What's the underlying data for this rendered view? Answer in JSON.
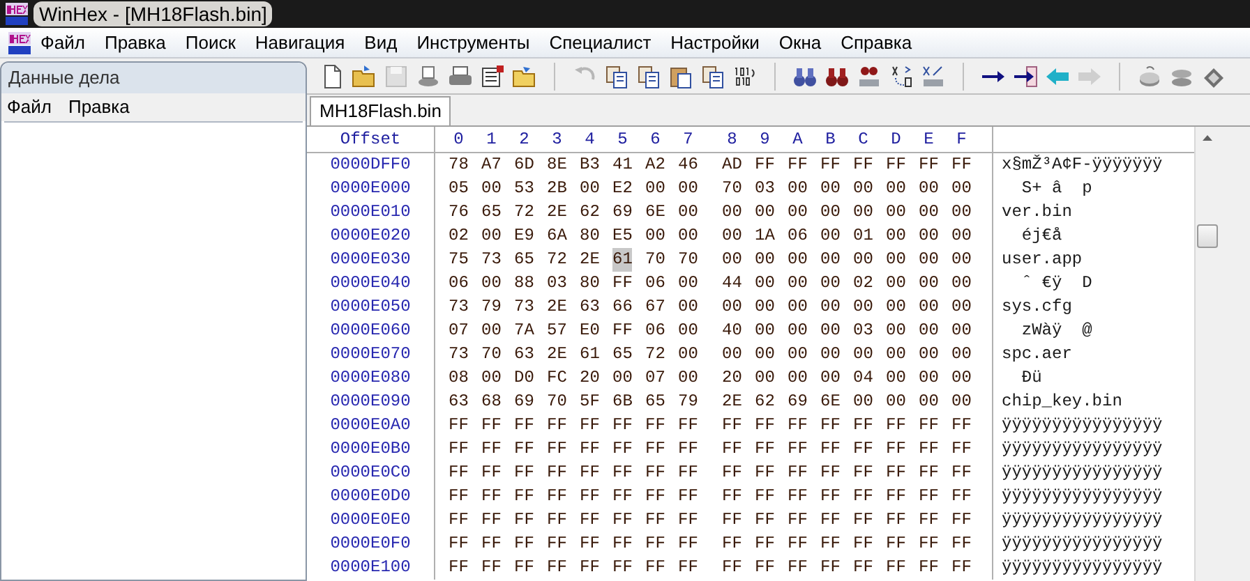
{
  "window": {
    "title": "WinHex - [MH18Flash.bin]"
  },
  "menu": [
    "Файл",
    "Правка",
    "Поиск",
    "Навигация",
    "Вид",
    "Инструменты",
    "Специалист",
    "Настройки",
    "Окна",
    "Справка"
  ],
  "side_panel": {
    "title": "Данные дела",
    "menu": [
      "Файл",
      "Правка"
    ]
  },
  "toolbar": [
    {
      "kind": "new",
      "disabled": false
    },
    {
      "kind": "open",
      "disabled": false
    },
    {
      "kind": "save",
      "disabled": true
    },
    {
      "kind": "disk",
      "disabled": false
    },
    {
      "kind": "print",
      "disabled": false
    },
    {
      "kind": "props",
      "disabled": false
    },
    {
      "kind": "folder",
      "disabled": false
    },
    {
      "kind": "sep"
    },
    {
      "kind": "undo",
      "disabled": true
    },
    {
      "kind": "copy",
      "disabled": false
    },
    {
      "kind": "copy",
      "disabled": false
    },
    {
      "kind": "paste",
      "disabled": false
    },
    {
      "kind": "copy",
      "disabled": false
    },
    {
      "kind": "binary",
      "disabled": false
    },
    {
      "kind": "sep"
    },
    {
      "kind": "find",
      "disabled": false
    },
    {
      "kind": "findred",
      "disabled": false
    },
    {
      "kind": "findhex",
      "disabled": false
    },
    {
      "kind": "replace",
      "disabled": false
    },
    {
      "kind": "replacehex",
      "disabled": false
    },
    {
      "kind": "sep"
    },
    {
      "kind": "goto",
      "disabled": false
    },
    {
      "kind": "gotobox",
      "disabled": false
    },
    {
      "kind": "back",
      "disabled": false
    },
    {
      "kind": "forward",
      "disabled": true
    },
    {
      "kind": "sep"
    },
    {
      "kind": "drive",
      "disabled": false
    },
    {
      "kind": "drives",
      "disabled": false
    },
    {
      "kind": "chip",
      "disabled": false
    }
  ],
  "tabs": [
    {
      "label": "MH18Flash.bin",
      "selected": true
    }
  ],
  "hex_view": {
    "offset_header": "Offset",
    "columns": [
      "0",
      "1",
      "2",
      "3",
      "4",
      "5",
      "6",
      "7",
      "8",
      "9",
      "A",
      "B",
      "C",
      "D",
      "E",
      "F"
    ],
    "rows": [
      {
        "offset": "0000DFF0",
        "bytes": [
          {
            "t": "78",
            "s": false
          },
          {
            "t": "A7",
            "s": false
          },
          {
            "t": "6D",
            "s": false
          },
          {
            "t": "8E",
            "s": false
          },
          {
            "t": "B3",
            "s": false
          },
          {
            "t": "41",
            "s": false
          },
          {
            "t": "A2",
            "s": false
          },
          {
            "t": "46",
            "s": false
          },
          {
            "t": "AD",
            "s": false
          },
          {
            "t": "FF",
            "s": false
          },
          {
            "t": "FF",
            "s": false
          },
          {
            "t": "FF",
            "s": false
          },
          {
            "t": "FF",
            "s": false
          },
          {
            "t": "FF",
            "s": false
          },
          {
            "t": "FF",
            "s": false
          },
          {
            "t": "FF",
            "s": false
          }
        ],
        "text": "x§mŽ³A¢F-ÿÿÿÿÿÿÿ"
      },
      {
        "offset": "0000E000",
        "bytes": [
          {
            "t": "05",
            "s": false
          },
          {
            "t": "00",
            "s": false
          },
          {
            "t": "53",
            "s": false
          },
          {
            "t": "2B",
            "s": false
          },
          {
            "t": "00",
            "s": false
          },
          {
            "t": "E2",
            "s": false
          },
          {
            "t": "00",
            "s": false
          },
          {
            "t": "00",
            "s": false
          },
          {
            "t": "70",
            "s": false
          },
          {
            "t": "03",
            "s": false
          },
          {
            "t": "00",
            "s": false
          },
          {
            "t": "00",
            "s": false
          },
          {
            "t": "00",
            "s": false
          },
          {
            "t": "00",
            "s": false
          },
          {
            "t": "00",
            "s": false
          },
          {
            "t": "00",
            "s": false
          }
        ],
        "text": "  S+ â  p"
      },
      {
        "offset": "0000E010",
        "bytes": [
          {
            "t": "76",
            "s": false
          },
          {
            "t": "65",
            "s": false
          },
          {
            "t": "72",
            "s": false
          },
          {
            "t": "2E",
            "s": false
          },
          {
            "t": "62",
            "s": false
          },
          {
            "t": "69",
            "s": false
          },
          {
            "t": "6E",
            "s": false
          },
          {
            "t": "00",
            "s": false
          },
          {
            "t": "00",
            "s": false
          },
          {
            "t": "00",
            "s": false
          },
          {
            "t": "00",
            "s": false
          },
          {
            "t": "00",
            "s": false
          },
          {
            "t": "00",
            "s": false
          },
          {
            "t": "00",
            "s": false
          },
          {
            "t": "00",
            "s": false
          },
          {
            "t": "00",
            "s": false
          }
        ],
        "text": "ver.bin"
      },
      {
        "offset": "0000E020",
        "bytes": [
          {
            "t": "02",
            "s": false
          },
          {
            "t": "00",
            "s": false
          },
          {
            "t": "E9",
            "s": false
          },
          {
            "t": "6A",
            "s": false
          },
          {
            "t": "80",
            "s": false
          },
          {
            "t": "E5",
            "s": false
          },
          {
            "t": "00",
            "s": false
          },
          {
            "t": "00",
            "s": false
          },
          {
            "t": "00",
            "s": false
          },
          {
            "t": "1A",
            "s": false
          },
          {
            "t": "06",
            "s": false
          },
          {
            "t": "00",
            "s": false
          },
          {
            "t": "01",
            "s": false
          },
          {
            "t": "00",
            "s": false
          },
          {
            "t": "00",
            "s": false
          },
          {
            "t": "00",
            "s": false
          }
        ],
        "text": "  éj€å"
      },
      {
        "offset": "0000E030",
        "bytes": [
          {
            "t": "75",
            "s": false
          },
          {
            "t": "73",
            "s": false
          },
          {
            "t": "65",
            "s": false
          },
          {
            "t": "72",
            "s": false
          },
          {
            "t": "2E",
            "s": false
          },
          {
            "t": "61",
            "s": true
          },
          {
            "t": "70",
            "s": false
          },
          {
            "t": "70",
            "s": false
          },
          {
            "t": "00",
            "s": false
          },
          {
            "t": "00",
            "s": false
          },
          {
            "t": "00",
            "s": false
          },
          {
            "t": "00",
            "s": false
          },
          {
            "t": "00",
            "s": false
          },
          {
            "t": "00",
            "s": false
          },
          {
            "t": "00",
            "s": false
          },
          {
            "t": "00",
            "s": false
          }
        ],
        "text": "user.app"
      },
      {
        "offset": "0000E040",
        "bytes": [
          {
            "t": "06",
            "s": false
          },
          {
            "t": "00",
            "s": false
          },
          {
            "t": "88",
            "s": false
          },
          {
            "t": "03",
            "s": false
          },
          {
            "t": "80",
            "s": false
          },
          {
            "t": "FF",
            "s": false
          },
          {
            "t": "06",
            "s": false
          },
          {
            "t": "00",
            "s": false
          },
          {
            "t": "44",
            "s": false
          },
          {
            "t": "00",
            "s": false
          },
          {
            "t": "00",
            "s": false
          },
          {
            "t": "00",
            "s": false
          },
          {
            "t": "02",
            "s": false
          },
          {
            "t": "00",
            "s": false
          },
          {
            "t": "00",
            "s": false
          },
          {
            "t": "00",
            "s": false
          }
        ],
        "text": "  ˆ €ÿ  D"
      },
      {
        "offset": "0000E050",
        "bytes": [
          {
            "t": "73",
            "s": false
          },
          {
            "t": "79",
            "s": false
          },
          {
            "t": "73",
            "s": false
          },
          {
            "t": "2E",
            "s": false
          },
          {
            "t": "63",
            "s": false
          },
          {
            "t": "66",
            "s": false
          },
          {
            "t": "67",
            "s": false
          },
          {
            "t": "00",
            "s": false
          },
          {
            "t": "00",
            "s": false
          },
          {
            "t": "00",
            "s": false
          },
          {
            "t": "00",
            "s": false
          },
          {
            "t": "00",
            "s": false
          },
          {
            "t": "00",
            "s": false
          },
          {
            "t": "00",
            "s": false
          },
          {
            "t": "00",
            "s": false
          },
          {
            "t": "00",
            "s": false
          }
        ],
        "text": "sys.cfg"
      },
      {
        "offset": "0000E060",
        "bytes": [
          {
            "t": "07",
            "s": false
          },
          {
            "t": "00",
            "s": false
          },
          {
            "t": "7A",
            "s": false
          },
          {
            "t": "57",
            "s": false
          },
          {
            "t": "E0",
            "s": false
          },
          {
            "t": "FF",
            "s": false
          },
          {
            "t": "06",
            "s": false
          },
          {
            "t": "00",
            "s": false
          },
          {
            "t": "40",
            "s": false
          },
          {
            "t": "00",
            "s": false
          },
          {
            "t": "00",
            "s": false
          },
          {
            "t": "00",
            "s": false
          },
          {
            "t": "03",
            "s": false
          },
          {
            "t": "00",
            "s": false
          },
          {
            "t": "00",
            "s": false
          },
          {
            "t": "00",
            "s": false
          }
        ],
        "text": "  zWàÿ  @"
      },
      {
        "offset": "0000E070",
        "bytes": [
          {
            "t": "73",
            "s": false
          },
          {
            "t": "70",
            "s": false
          },
          {
            "t": "63",
            "s": false
          },
          {
            "t": "2E",
            "s": false
          },
          {
            "t": "61",
            "s": false
          },
          {
            "t": "65",
            "s": false
          },
          {
            "t": "72",
            "s": false
          },
          {
            "t": "00",
            "s": false
          },
          {
            "t": "00",
            "s": false
          },
          {
            "t": "00",
            "s": false
          },
          {
            "t": "00",
            "s": false
          },
          {
            "t": "00",
            "s": false
          },
          {
            "t": "00",
            "s": false
          },
          {
            "t": "00",
            "s": false
          },
          {
            "t": "00",
            "s": false
          },
          {
            "t": "00",
            "s": false
          }
        ],
        "text": "spc.aer"
      },
      {
        "offset": "0000E080",
        "bytes": [
          {
            "t": "08",
            "s": false
          },
          {
            "t": "00",
            "s": false
          },
          {
            "t": "D0",
            "s": false
          },
          {
            "t": "FC",
            "s": false
          },
          {
            "t": "20",
            "s": false
          },
          {
            "t": "00",
            "s": false
          },
          {
            "t": "07",
            "s": false
          },
          {
            "t": "00",
            "s": false
          },
          {
            "t": "20",
            "s": false
          },
          {
            "t": "00",
            "s": false
          },
          {
            "t": "00",
            "s": false
          },
          {
            "t": "00",
            "s": false
          },
          {
            "t": "04",
            "s": false
          },
          {
            "t": "00",
            "s": false
          },
          {
            "t": "00",
            "s": false
          },
          {
            "t": "00",
            "s": false
          }
        ],
        "text": "  Ðü"
      },
      {
        "offset": "0000E090",
        "bytes": [
          {
            "t": "63",
            "s": false
          },
          {
            "t": "68",
            "s": false
          },
          {
            "t": "69",
            "s": false
          },
          {
            "t": "70",
            "s": false
          },
          {
            "t": "5F",
            "s": false
          },
          {
            "t": "6B",
            "s": false
          },
          {
            "t": "65",
            "s": false
          },
          {
            "t": "79",
            "s": false
          },
          {
            "t": "2E",
            "s": false
          },
          {
            "t": "62",
            "s": false
          },
          {
            "t": "69",
            "s": false
          },
          {
            "t": "6E",
            "s": false
          },
          {
            "t": "00",
            "s": false
          },
          {
            "t": "00",
            "s": false
          },
          {
            "t": "00",
            "s": false
          },
          {
            "t": "00",
            "s": false
          }
        ],
        "text": "chip_key.bin"
      },
      {
        "offset": "0000E0A0",
        "bytes": [
          {
            "t": "FF",
            "s": false
          },
          {
            "t": "FF",
            "s": false
          },
          {
            "t": "FF",
            "s": false
          },
          {
            "t": "FF",
            "s": false
          },
          {
            "t": "FF",
            "s": false
          },
          {
            "t": "FF",
            "s": false
          },
          {
            "t": "FF",
            "s": false
          },
          {
            "t": "FF",
            "s": false
          },
          {
            "t": "FF",
            "s": false
          },
          {
            "t": "FF",
            "s": false
          },
          {
            "t": "FF",
            "s": false
          },
          {
            "t": "FF",
            "s": false
          },
          {
            "t": "FF",
            "s": false
          },
          {
            "t": "FF",
            "s": false
          },
          {
            "t": "FF",
            "s": false
          },
          {
            "t": "FF",
            "s": false
          }
        ],
        "text": "ÿÿÿÿÿÿÿÿÿÿÿÿÿÿÿÿ"
      },
      {
        "offset": "0000E0B0",
        "bytes": [
          {
            "t": "FF",
            "s": false
          },
          {
            "t": "FF",
            "s": false
          },
          {
            "t": "FF",
            "s": false
          },
          {
            "t": "FF",
            "s": false
          },
          {
            "t": "FF",
            "s": false
          },
          {
            "t": "FF",
            "s": false
          },
          {
            "t": "FF",
            "s": false
          },
          {
            "t": "FF",
            "s": false
          },
          {
            "t": "FF",
            "s": false
          },
          {
            "t": "FF",
            "s": false
          },
          {
            "t": "FF",
            "s": false
          },
          {
            "t": "FF",
            "s": false
          },
          {
            "t": "FF",
            "s": false
          },
          {
            "t": "FF",
            "s": false
          },
          {
            "t": "FF",
            "s": false
          },
          {
            "t": "FF",
            "s": false
          }
        ],
        "text": "ÿÿÿÿÿÿÿÿÿÿÿÿÿÿÿÿ"
      },
      {
        "offset": "0000E0C0",
        "bytes": [
          {
            "t": "FF",
            "s": false
          },
          {
            "t": "FF",
            "s": false
          },
          {
            "t": "FF",
            "s": false
          },
          {
            "t": "FF",
            "s": false
          },
          {
            "t": "FF",
            "s": false
          },
          {
            "t": "FF",
            "s": false
          },
          {
            "t": "FF",
            "s": false
          },
          {
            "t": "FF",
            "s": false
          },
          {
            "t": "FF",
            "s": false
          },
          {
            "t": "FF",
            "s": false
          },
          {
            "t": "FF",
            "s": false
          },
          {
            "t": "FF",
            "s": false
          },
          {
            "t": "FF",
            "s": false
          },
          {
            "t": "FF",
            "s": false
          },
          {
            "t": "FF",
            "s": false
          },
          {
            "t": "FF",
            "s": false
          }
        ],
        "text": "ÿÿÿÿÿÿÿÿÿÿÿÿÿÿÿÿ"
      },
      {
        "offset": "0000E0D0",
        "bytes": [
          {
            "t": "FF",
            "s": false
          },
          {
            "t": "FF",
            "s": false
          },
          {
            "t": "FF",
            "s": false
          },
          {
            "t": "FF",
            "s": false
          },
          {
            "t": "FF",
            "s": false
          },
          {
            "t": "FF",
            "s": false
          },
          {
            "t": "FF",
            "s": false
          },
          {
            "t": "FF",
            "s": false
          },
          {
            "t": "FF",
            "s": false
          },
          {
            "t": "FF",
            "s": false
          },
          {
            "t": "FF",
            "s": false
          },
          {
            "t": "FF",
            "s": false
          },
          {
            "t": "FF",
            "s": false
          },
          {
            "t": "FF",
            "s": false
          },
          {
            "t": "FF",
            "s": false
          },
          {
            "t": "FF",
            "s": false
          }
        ],
        "text": "ÿÿÿÿÿÿÿÿÿÿÿÿÿÿÿÿ"
      },
      {
        "offset": "0000E0E0",
        "bytes": [
          {
            "t": "FF",
            "s": false
          },
          {
            "t": "FF",
            "s": false
          },
          {
            "t": "FF",
            "s": false
          },
          {
            "t": "FF",
            "s": false
          },
          {
            "t": "FF",
            "s": false
          },
          {
            "t": "FF",
            "s": false
          },
          {
            "t": "FF",
            "s": false
          },
          {
            "t": "FF",
            "s": false
          },
          {
            "t": "FF",
            "s": false
          },
          {
            "t": "FF",
            "s": false
          },
          {
            "t": "FF",
            "s": false
          },
          {
            "t": "FF",
            "s": false
          },
          {
            "t": "FF",
            "s": false
          },
          {
            "t": "FF",
            "s": false
          },
          {
            "t": "FF",
            "s": false
          },
          {
            "t": "FF",
            "s": false
          }
        ],
        "text": "ÿÿÿÿÿÿÿÿÿÿÿÿÿÿÿÿ"
      },
      {
        "offset": "0000E0F0",
        "bytes": [
          {
            "t": "FF",
            "s": false
          },
          {
            "t": "FF",
            "s": false
          },
          {
            "t": "FF",
            "s": false
          },
          {
            "t": "FF",
            "s": false
          },
          {
            "t": "FF",
            "s": false
          },
          {
            "t": "FF",
            "s": false
          },
          {
            "t": "FF",
            "s": false
          },
          {
            "t": "FF",
            "s": false
          },
          {
            "t": "FF",
            "s": false
          },
          {
            "t": "FF",
            "s": false
          },
          {
            "t": "FF",
            "s": false
          },
          {
            "t": "FF",
            "s": false
          },
          {
            "t": "FF",
            "s": false
          },
          {
            "t": "FF",
            "s": false
          },
          {
            "t": "FF",
            "s": false
          },
          {
            "t": "FF",
            "s": false
          }
        ],
        "text": "ÿÿÿÿÿÿÿÿÿÿÿÿÿÿÿÿ"
      },
      {
        "offset": "0000E100",
        "bytes": [
          {
            "t": "FF",
            "s": false
          },
          {
            "t": "FF",
            "s": false
          },
          {
            "t": "FF",
            "s": false
          },
          {
            "t": "FF",
            "s": false
          },
          {
            "t": "FF",
            "s": false
          },
          {
            "t": "FF",
            "s": false
          },
          {
            "t": "FF",
            "s": false
          },
          {
            "t": "FF",
            "s": false
          },
          {
            "t": "FF",
            "s": false
          },
          {
            "t": "FF",
            "s": false
          },
          {
            "t": "FF",
            "s": false
          },
          {
            "t": "FF",
            "s": false
          },
          {
            "t": "FF",
            "s": false
          },
          {
            "t": "FF",
            "s": false
          },
          {
            "t": "FF",
            "s": false
          },
          {
            "t": "FF",
            "s": false
          }
        ],
        "text": "ÿÿÿÿÿÿÿÿÿÿÿÿÿÿÿÿ"
      }
    ]
  }
}
